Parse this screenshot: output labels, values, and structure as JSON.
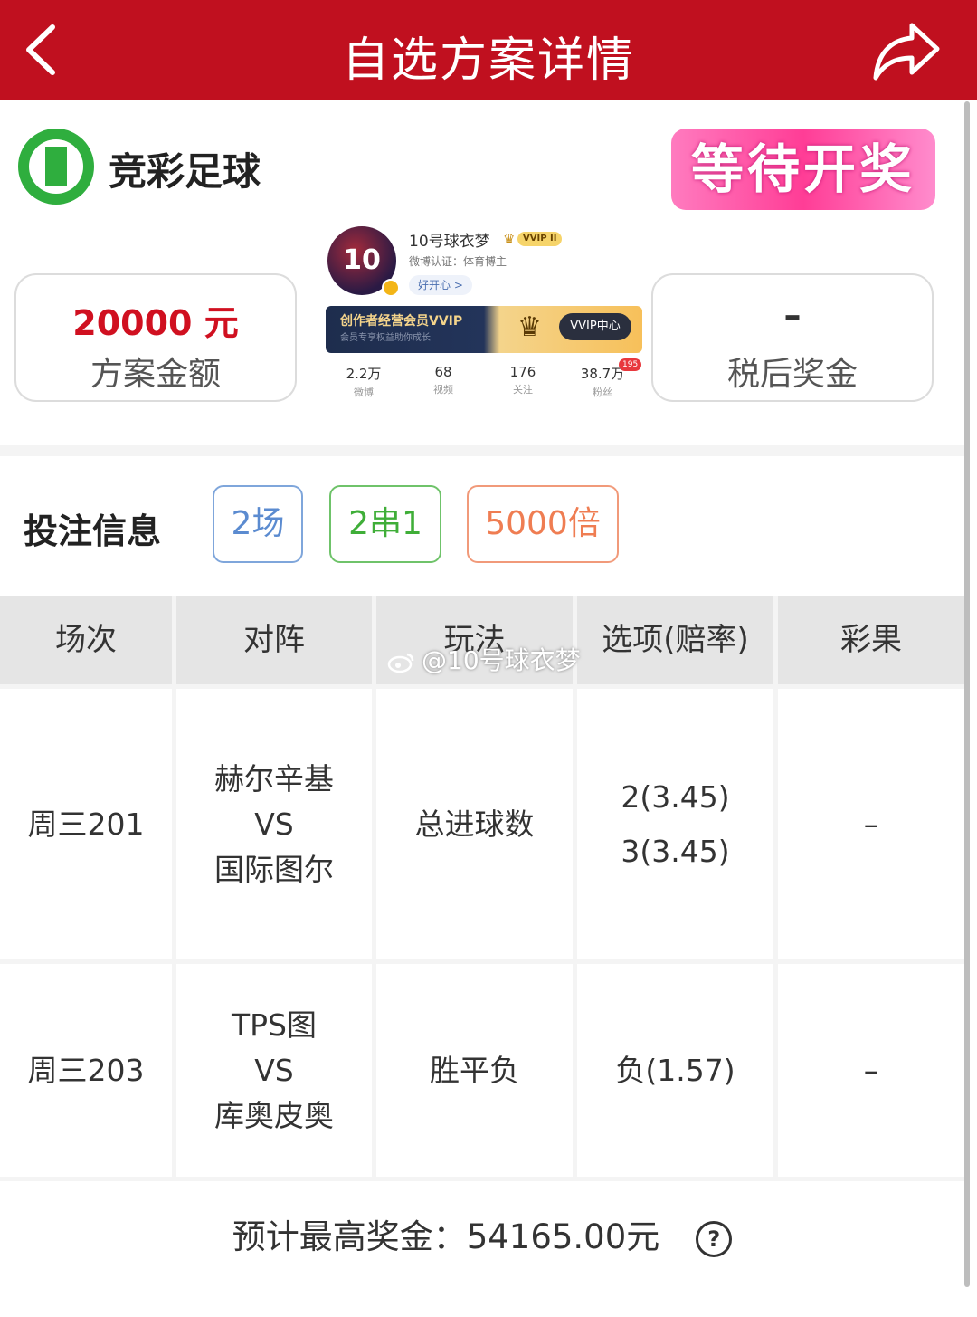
{
  "header": {
    "title": "自选方案详情",
    "back_icon": "chevron-left-icon",
    "share_icon": "share-arrow-icon",
    "bg_color": "#c0101f"
  },
  "brand": {
    "name": "竞彩足球",
    "promo": "等待开奖"
  },
  "plan_amount": {
    "value": "20000 元",
    "label": "方案金额"
  },
  "after_tax_prize": {
    "value": "–",
    "label": "税后奖金"
  },
  "profile": {
    "name": "10号球衣梦",
    "vip_badge": "VVIP II",
    "certification": "微博认证：体育博主",
    "mood": "好开心 >",
    "avatar_number": "10",
    "vip_bar_title": "创作者经营会员VVIP",
    "vip_bar_sub": "会员专享权益助你成长",
    "vip_center": "VVIP中心",
    "stats": [
      {
        "num": "2.2万",
        "unit": "微博"
      },
      {
        "num": "68",
        "unit": "视频"
      },
      {
        "num": "176",
        "unit": "关注"
      },
      {
        "num": "38.7万",
        "unit": "粉丝"
      }
    ],
    "fans_badge": "195"
  },
  "bet_info": {
    "label": "投注信息",
    "matches": "2场",
    "combo": "2串1",
    "multiplier": "5000倍"
  },
  "table": {
    "headers": [
      "场次",
      "对阵",
      "玩法",
      "选项(赔率)",
      "彩果"
    ],
    "rows": [
      {
        "session": "周三201",
        "home": "赫尔辛基",
        "vs": "VS",
        "away": "国际图尔",
        "play": "总进球数",
        "options": [
          "2(3.45)",
          "3(3.45)"
        ],
        "result": "–"
      },
      {
        "session": "周三203",
        "home": "TPS图",
        "vs": "VS",
        "away": "库奥皮奥",
        "play": "胜平负",
        "options": [
          "负(1.57)"
        ],
        "result": "–"
      }
    ]
  },
  "watermark": "@10号球衣梦",
  "footer": {
    "label": "预计最高奖金：",
    "value": "54165.00元",
    "help_icon": "question-circle-icon"
  }
}
